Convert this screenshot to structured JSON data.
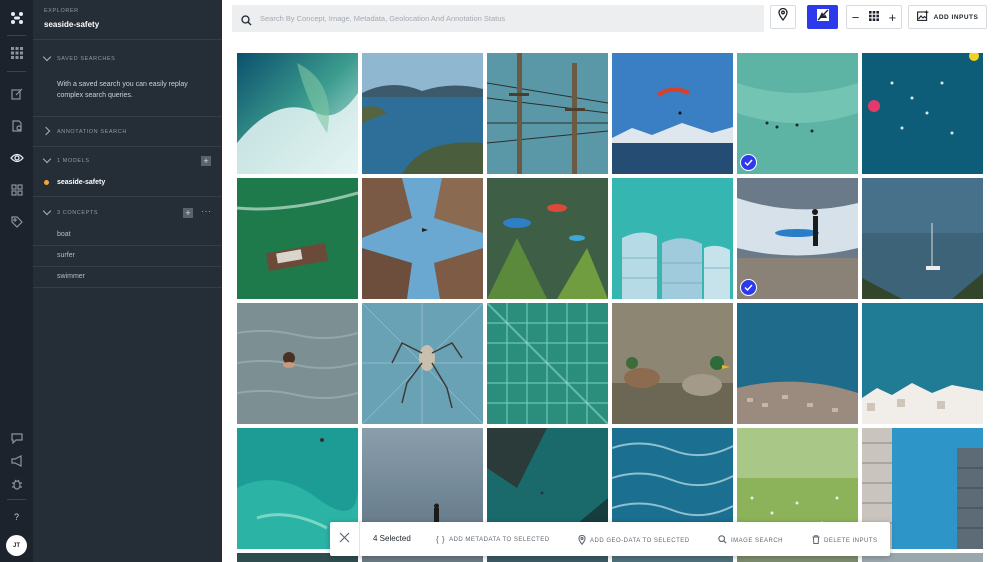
{
  "sidebar": {
    "section_label": "EXPLORER",
    "app_name": "seaside-safety",
    "saved_searches": {
      "label": "SAVED SEARCHES",
      "description": "With a saved search you can easily replay complex search queries."
    },
    "annotation_search": {
      "label": "ANNOTATION SEARCH"
    },
    "models": {
      "label": "1 MODELS",
      "items": [
        {
          "name": "seaside-safety",
          "status_color": "#f7a537"
        }
      ]
    },
    "concepts": {
      "label": "3 CONCEPTS",
      "items": [
        {
          "name": "boat"
        },
        {
          "name": "surfer"
        },
        {
          "name": "swimmer"
        }
      ]
    }
  },
  "rail": {
    "icons": [
      "logo-icon",
      "apps-grid-icon",
      "edit-icon",
      "document-icon",
      "eye-icon",
      "modules-icon",
      "tag-icon",
      "chat-icon",
      "megaphone-icon",
      "bug-icon",
      "help-icon"
    ],
    "help_text": "?",
    "avatar_initials": "JT"
  },
  "toolbar": {
    "search_placeholder": "Search By Concept, Image, Metadata, Geolocation And Annotation Status",
    "add_inputs_label": "ADD INPUTS",
    "accent": "#2d3aeb"
  },
  "grid": {
    "tiles": [
      {
        "desc": "wave",
        "selected": false
      },
      {
        "desc": "coast",
        "selected": false
      },
      {
        "desc": "power-lines",
        "selected": false
      },
      {
        "desc": "paraglider",
        "selected": false
      },
      {
        "desc": "surfers",
        "selected": true
      },
      {
        "desc": "swimmers",
        "selected": false
      },
      {
        "desc": "boat",
        "selected": false
      },
      {
        "desc": "buildings-sky",
        "selected": false
      },
      {
        "desc": "fish",
        "selected": false
      },
      {
        "desc": "glass-towers",
        "selected": false
      },
      {
        "desc": "surfer-beach",
        "selected": true
      },
      {
        "desc": "sailboat",
        "selected": false
      },
      {
        "desc": "swimmer",
        "selected": false
      },
      {
        "desc": "spider",
        "selected": false
      },
      {
        "desc": "glass-facade",
        "selected": false
      },
      {
        "desc": "ducks",
        "selected": false
      },
      {
        "desc": "aerial-town",
        "selected": false
      },
      {
        "desc": "white-town",
        "selected": false
      },
      {
        "desc": "reef",
        "selected": false
      },
      {
        "desc": "foggy-figure",
        "selected": true
      },
      {
        "desc": "cliff-sea",
        "selected": false
      },
      {
        "desc": "aerial-waves",
        "selected": true
      },
      {
        "desc": "meadow",
        "selected": false
      },
      {
        "desc": "skyscraper",
        "selected": false
      }
    ]
  },
  "selection_bar": {
    "count_label": "4 Selected",
    "actions": [
      {
        "label": "ADD METADATA TO SELECTED",
        "icon": "braces-icon"
      },
      {
        "label": "ADD GEO-DATA TO SELECTED",
        "icon": "map-pin-icon"
      },
      {
        "label": "IMAGE SEARCH",
        "icon": "search-icon"
      },
      {
        "label": "DELETE INPUTS",
        "icon": "trash-icon"
      }
    ]
  }
}
